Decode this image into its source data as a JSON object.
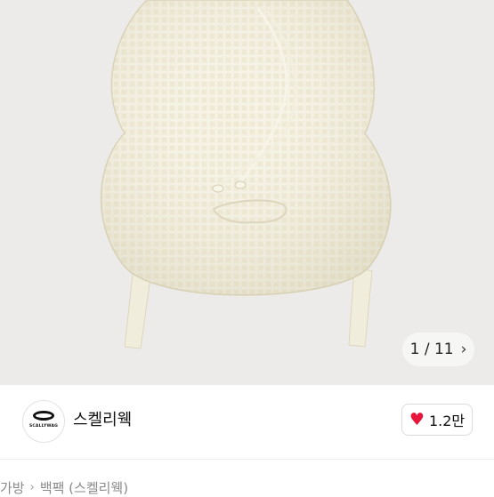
{
  "gallery": {
    "current": "1",
    "total": "11",
    "separator": "/",
    "next_icon": "chevron-right-icon"
  },
  "shop": {
    "logo_text": "SCALLYWAG",
    "name": "스켈리웩"
  },
  "like": {
    "icon": "heart-icon",
    "count": "1.2만",
    "color": "#e8143a"
  },
  "breadcrumb": {
    "items": [
      "가방",
      "백팩 (스켈리웩)"
    ],
    "separator_icon": "chevron-right-icon"
  }
}
